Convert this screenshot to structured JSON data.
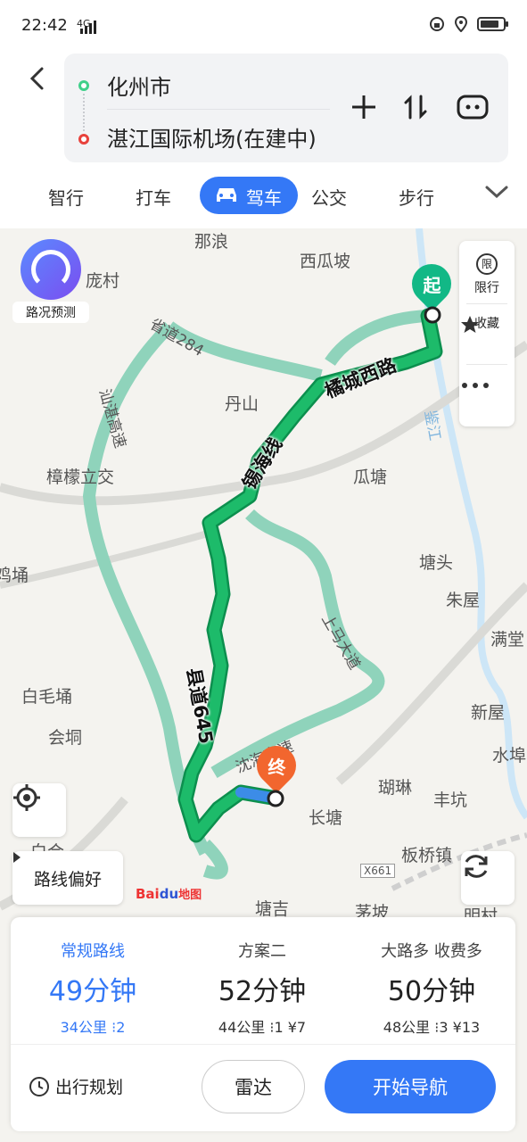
{
  "status": {
    "time": "22:42",
    "network": "4G"
  },
  "route": {
    "from": "化州市",
    "to": "湛江国际机场(在建中)"
  },
  "modes": [
    "智行",
    "打车",
    "驾车",
    "公交",
    "步行"
  ],
  "active_mode": "驾车",
  "map": {
    "traffic_label": "路况预测",
    "side": {
      "restrict_badge": "限",
      "restrict": "限行",
      "favorite": "收藏"
    },
    "start_marker": "起",
    "end_marker": "终",
    "route_pref": "路线偏好",
    "brand": {
      "bai": "Bai",
      "du": "du",
      "map": "地图"
    },
    "places": [
      "那浪",
      "西瓜坡",
      "庞村",
      "丹山",
      "樟檬立交",
      "瓜塘",
      "塘头",
      "朱屋",
      "满堂",
      "白毛埇",
      "新屋",
      "会垌",
      "水埠",
      "瑚琳",
      "丰坑",
      "长塘",
      "板桥镇",
      "白合",
      "塘吉",
      "茅坡",
      "明村",
      "X661",
      "鸡埇"
    ],
    "roads": [
      "橘城西路",
      "锡海线",
      "县道645",
      "省道284",
      "汕湛高速",
      "上马大道",
      "沈海高速",
      "鉴江"
    ]
  },
  "plans": [
    {
      "name": "常规路线",
      "time": "49分钟",
      "distance": "34公里",
      "lights": "2"
    },
    {
      "name": "方案二",
      "time": "52分钟",
      "distance": "44公里",
      "lights": "1",
      "toll": "¥7"
    },
    {
      "name": "大路多 收费多",
      "time": "50分钟",
      "distance": "48公里",
      "lights": "3",
      "toll": "¥13"
    }
  ],
  "actions": {
    "schedule": "出行规划",
    "radar": "雷达",
    "start": "开始导航"
  },
  "colors": {
    "accent": "#3478f6",
    "route": "#1dbb6a",
    "alt_route": "#8fd3bb",
    "start": "#12b886",
    "end": "#f2662e"
  }
}
